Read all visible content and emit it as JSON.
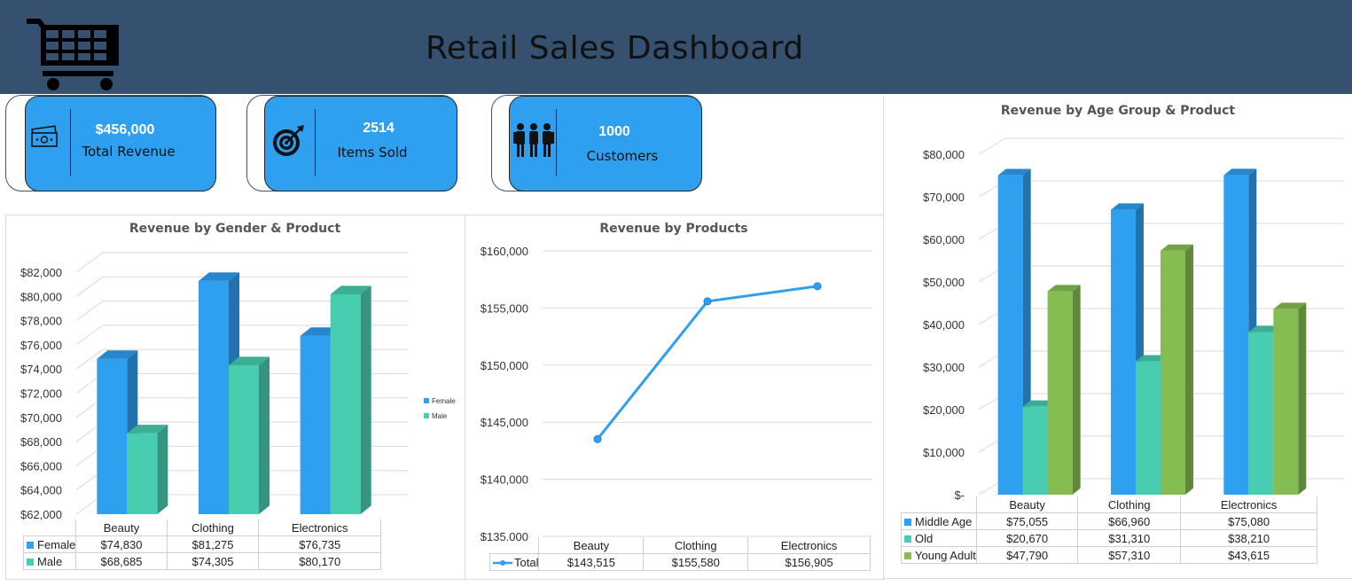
{
  "dashboard": {
    "title": "Retail Sales Dashboard"
  },
  "kpis": [
    {
      "value": "$456,000",
      "label": "Total Revenue",
      "icon": "money-icon"
    },
    {
      "value": "2514",
      "label": "Items Sold",
      "icon": "target-icon"
    },
    {
      "value": "1000",
      "label": "Customers",
      "icon": "people-icon"
    }
  ],
  "colors": {
    "header": "#36506f",
    "kpi": "#2f9ff0",
    "blue": "#2f9ff0",
    "teal": "#48cdb0",
    "green": "#86bd52"
  },
  "chart_data": [
    {
      "type": "bar",
      "title": "Revenue by Gender & Product",
      "categories": [
        "Beauty",
        "Clothing",
        "Electronics"
      ],
      "series": [
        {
          "name": "Female",
          "values": [
            74830,
            81275,
            76735
          ],
          "labels": [
            "$74,830",
            "$81,275",
            "$76,735"
          ],
          "color": "#2f9ff0"
        },
        {
          "name": "Male",
          "values": [
            68685,
            74305,
            80170
          ],
          "labels": [
            "$68,685",
            "$74,305",
            "$80,170"
          ],
          "color": "#48cdb0"
        }
      ],
      "ylim": [
        62000,
        82000
      ],
      "yticks": [
        "$62,000",
        "$64,000",
        "$66,000",
        "$68,000",
        "$70,000",
        "$72,000",
        "$74,000",
        "$76,000",
        "$78,000",
        "$80,000",
        "$82,000"
      ],
      "legend": "right",
      "grid": true
    },
    {
      "type": "line",
      "title": "Revenue by Products",
      "categories": [
        "Beauty",
        "Clothing",
        "Electronics"
      ],
      "series": [
        {
          "name": "Total",
          "values": [
            143515,
            155580,
            156905
          ],
          "labels": [
            "$143,515",
            "$155,580",
            "$156,905"
          ],
          "color": "#2f9ff0"
        }
      ],
      "ylim": [
        135000,
        160000
      ],
      "yticks": [
        "$135,000",
        "$140,000",
        "$145,000",
        "$150,000",
        "$155,000",
        "$160,000"
      ],
      "grid": true
    },
    {
      "type": "bar",
      "title": "Revenue by Age Group & Product",
      "categories": [
        "Beauty",
        "Clothing",
        "Electronics"
      ],
      "series": [
        {
          "name": "Middle Age",
          "values": [
            75055,
            66960,
            75080
          ],
          "labels": [
            "$75,055",
            "$66,960",
            "$75,080"
          ],
          "color": "#2f9ff0"
        },
        {
          "name": "Old",
          "values": [
            20670,
            31310,
            38210
          ],
          "labels": [
            "$20,670",
            "$31,310",
            "$38,210"
          ],
          "color": "#48cdb0"
        },
        {
          "name": "Young Adult",
          "values": [
            47790,
            57310,
            43615
          ],
          "labels": [
            "$47,790",
            "$57,310",
            "$43,615"
          ],
          "color": "#86bd52"
        }
      ],
      "ylim": [
        0,
        80000
      ],
      "yticks": [
        "$-",
        "$10,000",
        "$20,000",
        "$30,000",
        "$40,000",
        "$50,000",
        "$60,000",
        "$70,000",
        "$80,000"
      ],
      "grid": true
    }
  ]
}
